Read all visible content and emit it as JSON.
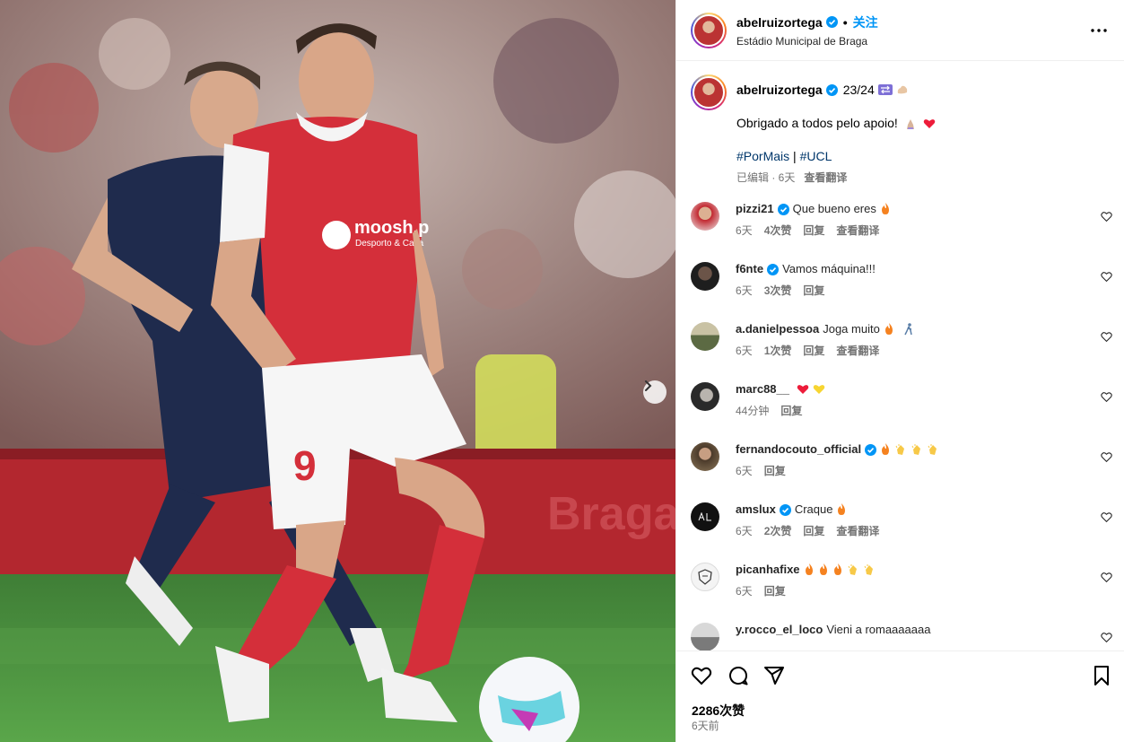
{
  "post": {
    "username": "abelruizortega",
    "follow_label": "关注",
    "location": "Estádio Municipal de Braga",
    "more_label": "更多选项",
    "carousel_next_label": "下一张"
  },
  "caption": {
    "username": "abelruizortega",
    "title": "23/24",
    "line1": "Obrigado a todos pelo apoio!",
    "tag1": "#PorMais",
    "tag_sep": "|",
    "tag2": "#UCL",
    "edited": "已编辑 · 6天",
    "translate": "查看翻译"
  },
  "comments": [
    {
      "user": "pizzi21",
      "verified": true,
      "text": "Que bueno eres",
      "time": "6天",
      "likes": "4次赞",
      "reply": "回复",
      "translate": "查看翻译"
    },
    {
      "user": "f6nte",
      "verified": true,
      "text": "Vamos máquina!!!",
      "time": "6天",
      "likes": "3次赞",
      "reply": "回复",
      "translate": ""
    },
    {
      "user": "a.danielpessoa",
      "verified": false,
      "text": "Joga muito",
      "time": "6天",
      "likes": "1次赞",
      "reply": "回复",
      "translate": "查看翻译"
    },
    {
      "user": "marc88__",
      "verified": false,
      "text": "",
      "time": "44分钟",
      "likes": "",
      "reply": "回复",
      "translate": ""
    },
    {
      "user": "fernandocouto_official",
      "verified": true,
      "text": "",
      "time": "6天",
      "likes": "",
      "reply": "回复",
      "translate": ""
    },
    {
      "user": "amslux",
      "verified": true,
      "text": "Craque",
      "time": "6天",
      "likes": "2次赞",
      "reply": "回复",
      "translate": "查看翻译"
    },
    {
      "user": "picanhafixe",
      "verified": false,
      "text": "",
      "time": "6天",
      "likes": "",
      "reply": "回复",
      "translate": ""
    },
    {
      "user": "y.rocco_el_loco",
      "verified": false,
      "text": "Vieni a romaaaaaaa",
      "time": "",
      "likes": "",
      "reply": "",
      "translate": ""
    }
  ],
  "footer": {
    "likes": "2286次赞",
    "posted": "6天前"
  },
  "colors": {
    "accent": "#0095f6",
    "hashtag": "#00376b",
    "muted": "#737373",
    "heart": "#ed4956",
    "fire": "#f58220",
    "clap": "#f7c948"
  },
  "icons": {
    "heart": "heart-icon",
    "comment": "comment-icon",
    "share": "share-icon",
    "save": "bookmark-icon",
    "more": "more-icon",
    "verified": "verified-badge-icon",
    "next": "chevron-right-icon"
  }
}
